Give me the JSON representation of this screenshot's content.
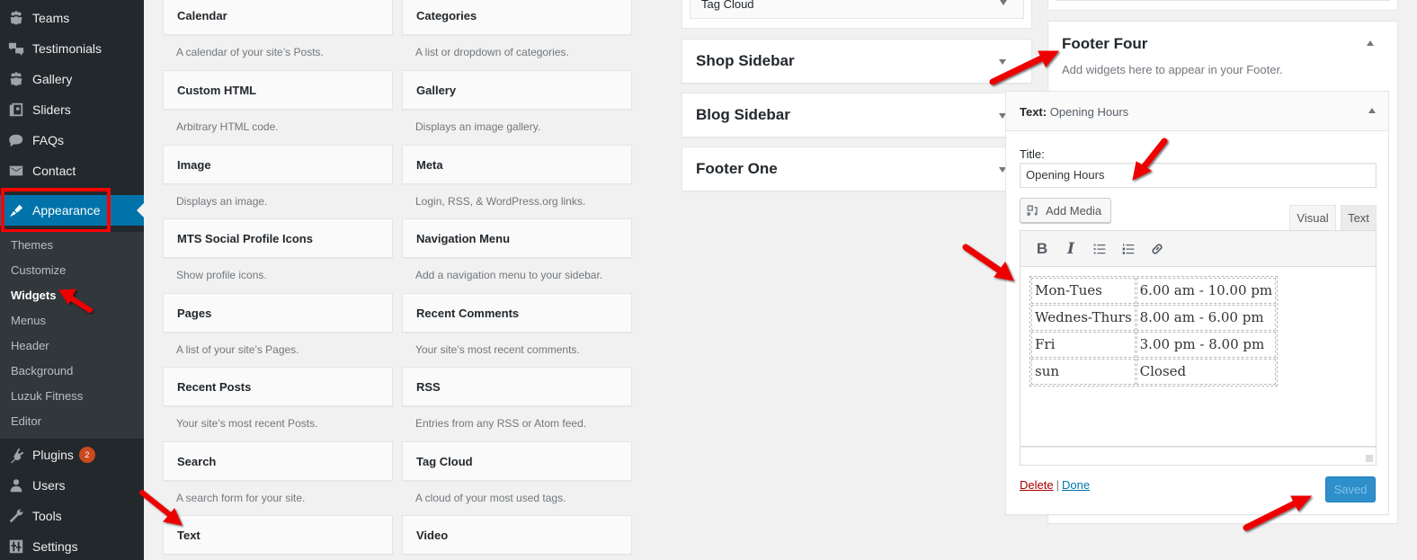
{
  "admin_menu": {
    "items": [
      {
        "label": "Teams",
        "icon": "groups-icon"
      },
      {
        "label": "Testimonials",
        "icon": "testimonial-icon"
      },
      {
        "label": "Gallery",
        "icon": "groups-icon"
      },
      {
        "label": "Sliders",
        "icon": "slides-icon"
      },
      {
        "label": "FAQs",
        "icon": "format-chat-icon"
      },
      {
        "label": "Contact",
        "icon": "email-icon"
      },
      {
        "label": "Appearance",
        "icon": "paintbrush-icon",
        "current": true
      },
      {
        "label": "Plugins",
        "icon": "plugins-icon",
        "badge": "2"
      },
      {
        "label": "Users",
        "icon": "users-icon"
      },
      {
        "label": "Tools",
        "icon": "wrench-icon"
      },
      {
        "label": "Settings",
        "icon": "settings-icon"
      }
    ],
    "appearance_submenu": [
      "Themes",
      "Customize",
      "Widgets",
      "Menus",
      "Header",
      "Background",
      "Luzuk Fitness",
      "Editor"
    ],
    "current_submenu": "Widgets"
  },
  "available_widgets": [
    {
      "name": "Calendar",
      "desc": "A calendar of your site’s Posts."
    },
    {
      "name": "Categories",
      "desc": "A list or dropdown of categories."
    },
    {
      "name": "Custom HTML",
      "desc": "Arbitrary HTML code."
    },
    {
      "name": "Gallery",
      "desc": "Displays an image gallery."
    },
    {
      "name": "Image",
      "desc": "Displays an image."
    },
    {
      "name": "Meta",
      "desc": "Login, RSS, & WordPress.org links."
    },
    {
      "name": "MTS Social Profile Icons",
      "desc": "Show profile icons."
    },
    {
      "name": "Navigation Menu",
      "desc": "Add a navigation menu to your sidebar."
    },
    {
      "name": "Pages",
      "desc": "A list of your site’s Pages."
    },
    {
      "name": "Recent Comments",
      "desc": "Your site’s most recent comments."
    },
    {
      "name": "Recent Posts",
      "desc": "Your site’s most recent Posts."
    },
    {
      "name": "RSS",
      "desc": "Entries from any RSS or Atom feed."
    },
    {
      "name": "Search",
      "desc": "A search form for your site."
    },
    {
      "name": "Tag Cloud",
      "desc": "A cloud of your most used tags."
    },
    {
      "name": "Text",
      "desc": ""
    },
    {
      "name": "Video",
      "desc": ""
    }
  ],
  "sidebars": {
    "partial_widget": "Tag Cloud",
    "areas": [
      "Shop Sidebar",
      "Blog Sidebar",
      "Footer One"
    ]
  },
  "footer_four": {
    "title": "Footer Four",
    "description": "Add widgets here to appear in your Footer."
  },
  "text_widget": {
    "head_prefix": "Text:",
    "head_title": "Opening Hours",
    "title_label": "Title:",
    "title_value": "Opening Hours",
    "add_media_label": "Add Media",
    "tabs": {
      "visual": "Visual",
      "text": "Text"
    },
    "toolbar": {
      "bold": "B",
      "italic": "I"
    },
    "hours_table": [
      [
        "Mon-Tues",
        "6.00 am - 10.00 pm"
      ],
      [
        "Wednes-Thurs",
        "8.00 am - 6.00 pm"
      ],
      [
        "Fri",
        "3.00 pm - 8.00 pm"
      ],
      [
        "sun",
        "Closed"
      ]
    ],
    "delete_label": "Delete",
    "separator": "|",
    "done_label": "Done",
    "saved_label": "Saved"
  },
  "colors": {
    "admin_bg": "#23282d",
    "submenu_bg": "#32373c",
    "accent": "#0073aa",
    "annotation_red": "#ff0000",
    "badge": "#ca4a1f",
    "saved_button": "#2e8fcb"
  }
}
